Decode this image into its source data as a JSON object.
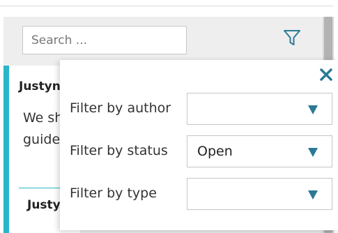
{
  "search": {
    "placeholder": "Search ..."
  },
  "card": {
    "author": "Justyna",
    "body": "We sh\nguide",
    "next_author": "Justy"
  },
  "filter_popup": {
    "filters": [
      {
        "label": "Filter by author",
        "value": ""
      },
      {
        "label": "Filter by status",
        "value": "Open"
      },
      {
        "label": "Filter by type",
        "value": ""
      }
    ]
  },
  "icons": {
    "filter": "funnel-icon",
    "close": "close-icon",
    "dropdown": "triangle-down-icon"
  },
  "colors": {
    "accent": "#29b6c8",
    "icon": "#2a7a96"
  }
}
